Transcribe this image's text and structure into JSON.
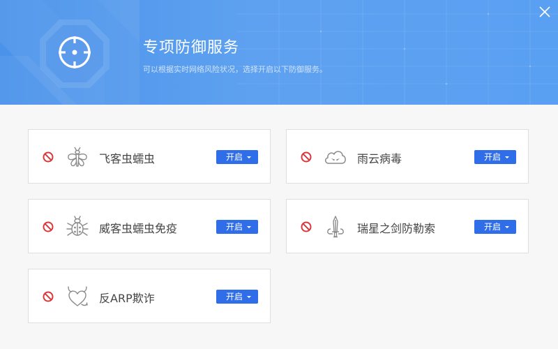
{
  "header": {
    "title": "专项防御服务",
    "subtitle": "可以根据实时网络风险状况，选择开启以下防御服务。"
  },
  "colors": {
    "header_blue": "#4a92ea",
    "button_blue": "#2f6ee8",
    "status_red": "#d9383a",
    "icon_gray": "#8a8a8a"
  },
  "services": [
    {
      "label": "飞客虫蠕虫",
      "button": "开启",
      "icon": "moth-icon",
      "status": "disabled"
    },
    {
      "label": "雨云病毒",
      "button": "开启",
      "icon": "angry-cloud-icon",
      "status": "disabled"
    },
    {
      "label": "威客虫蠕虫免疫",
      "button": "开启",
      "icon": "bug-icon",
      "status": "disabled"
    },
    {
      "label": "瑞星之剑防勒索",
      "button": "开启",
      "icon": "sword-icon",
      "status": "disabled"
    },
    {
      "label": "反ARP欺诈",
      "button": "开启",
      "icon": "devil-heart-icon",
      "status": "disabled"
    }
  ]
}
